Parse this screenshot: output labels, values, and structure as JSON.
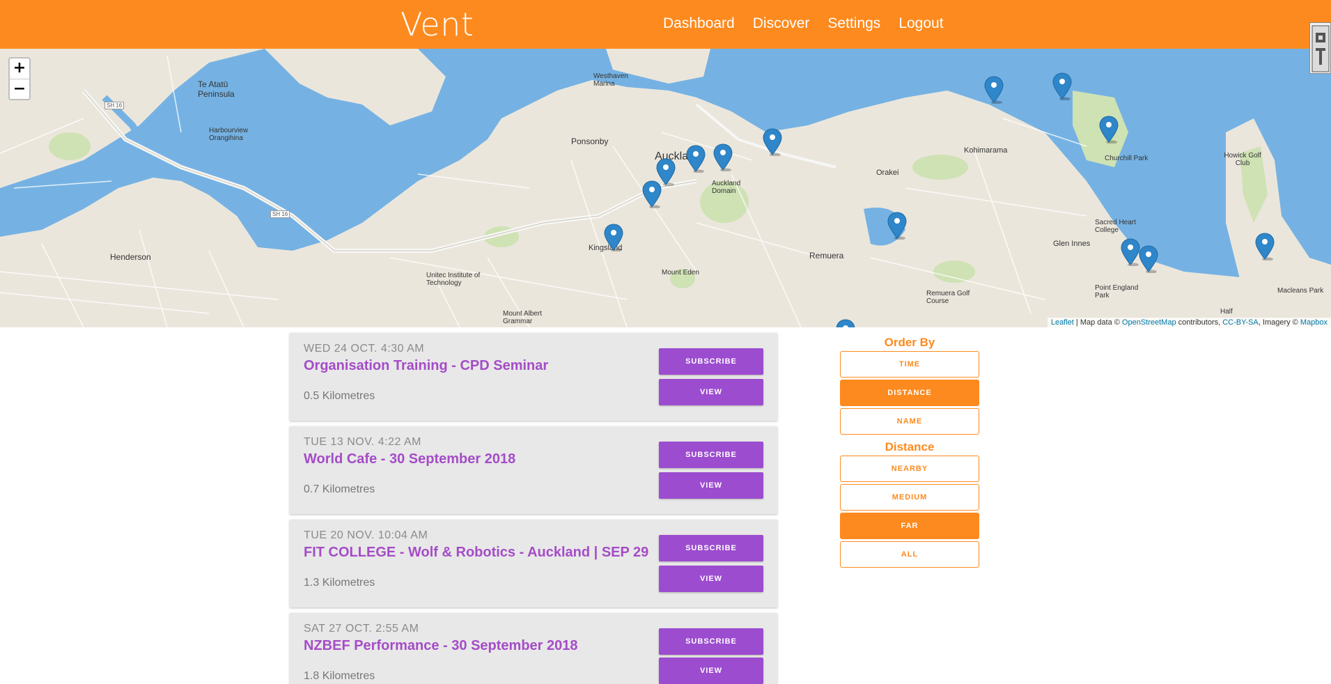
{
  "header": {
    "brand": "Vent",
    "nav": [
      "Dashboard",
      "Discover",
      "Settings",
      "Logout"
    ]
  },
  "map": {
    "zoom_in": "+",
    "zoom_out": "−",
    "attribution": {
      "leaflet": "Leaflet",
      "sep": " | Map data © ",
      "osm": "OpenStreetMap",
      "contrib": " contributors, ",
      "license": "CC-BY-SA",
      "imagery": ", Imagery © ",
      "mapbox": "Mapbox"
    },
    "labels": {
      "auckland": "Auckland",
      "te_atatu": "Te Atatū Peninsula",
      "harbourview": "Harbourview Orangihina",
      "henderson": "Henderson",
      "westhaven": "Westhaven Marina",
      "ponsonby": "Ponsonby",
      "kingsland": "Kingsland",
      "unitec": "Unitec Institute of Technology",
      "mount_albert": "Mount Albert Grammar",
      "mount_eden": "Mount Eden",
      "domain": "Auckland Domain",
      "remuera": "Remuera",
      "remuera_golf": "Remuera Golf Course",
      "orakei": "Orakei",
      "kohimarama": "Kohimarama",
      "churchill": "Churchill Park",
      "glen_innes": "Glen Innes",
      "sacred_heart": "Sacred Heart College",
      "point_england": "Point England Park",
      "howick_golf": "Howick Golf Club",
      "macleans": "Macleans Park",
      "half": "Half",
      "sh16a": "SH 16",
      "sh16b": "SH 16"
    }
  },
  "events": [
    {
      "date": "WED 24 OCT. 4:30 AM",
      "title": "Organisation Training - CPD Seminar",
      "distance": "0.5 Kilometres",
      "subscribe": "SUBSCRIBE",
      "view": "VIEW"
    },
    {
      "date": "TUE 13 NOV. 4:22 AM",
      "title": "World Cafe - 30 September 2018",
      "distance": "0.7 Kilometres",
      "subscribe": "SUBSCRIBE",
      "view": "VIEW"
    },
    {
      "date": "TUE 20 NOV. 10:04 AM",
      "title": "FIT COLLEGE - Wolf & Robotics - Auckland | SEP 29",
      "distance": "1.3 Kilometres",
      "subscribe": "SUBSCRIBE",
      "view": "VIEW"
    },
    {
      "date": "SAT 27 OCT. 2:55 AM",
      "title": "NZBEF Performance - 30 September 2018",
      "distance": "1.8 Kilometres",
      "subscribe": "SUBSCRIBE",
      "view": "VIEW"
    }
  ],
  "sidebar": {
    "order_by_heading": "Order By",
    "order_options": [
      "TIME",
      "DISTANCE",
      "NAME"
    ],
    "order_selected": "DISTANCE",
    "distance_heading": "Distance",
    "distance_options": [
      "NEARBY",
      "MEDIUM",
      "FAR",
      "ALL"
    ],
    "distance_selected": "FAR"
  },
  "colors": {
    "brand": "#fd8a1e",
    "button": "#9c4ccf",
    "title": "#a44cc7",
    "water": "#75b2e3",
    "marker": "#2f86c9"
  },
  "icons": [
    "map-marker-icon",
    "zoom-in-icon",
    "zoom-out-icon"
  ]
}
